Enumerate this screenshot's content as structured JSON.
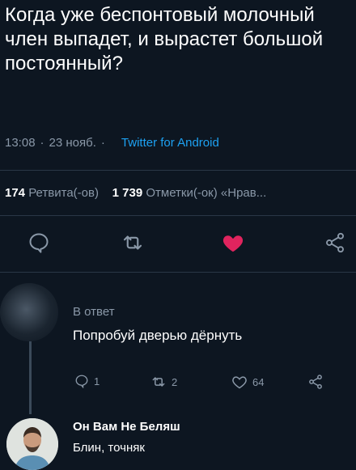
{
  "tweet": {
    "text": "Когда уже беспонтовый молочный член выпадет, и вырастет большой постоянный?",
    "time": "13:08",
    "date": "23 нояб.",
    "source": "Twitter for Android",
    "retweets_count": "174",
    "retweets_label": "Ретвита(-ов)",
    "likes_count": "1 739",
    "likes_label": "Отметки(-ок) «Нрав...",
    "liked": true
  },
  "reply": {
    "reply_to": "В ответ",
    "text": "Попробуй дверью дёрнуть",
    "reply_count": "1",
    "retweet_count": "2",
    "like_count": "64"
  },
  "reply2": {
    "author": "Он Вам Не Беляш",
    "text": "Блин, точняк"
  },
  "colors": {
    "background": "#0d1621",
    "link": "#1da1f2",
    "like": "#e0245e",
    "muted": "#8a98a8"
  },
  "icons": [
    "reply-icon",
    "retweet-icon",
    "like-icon",
    "share-icon"
  ]
}
